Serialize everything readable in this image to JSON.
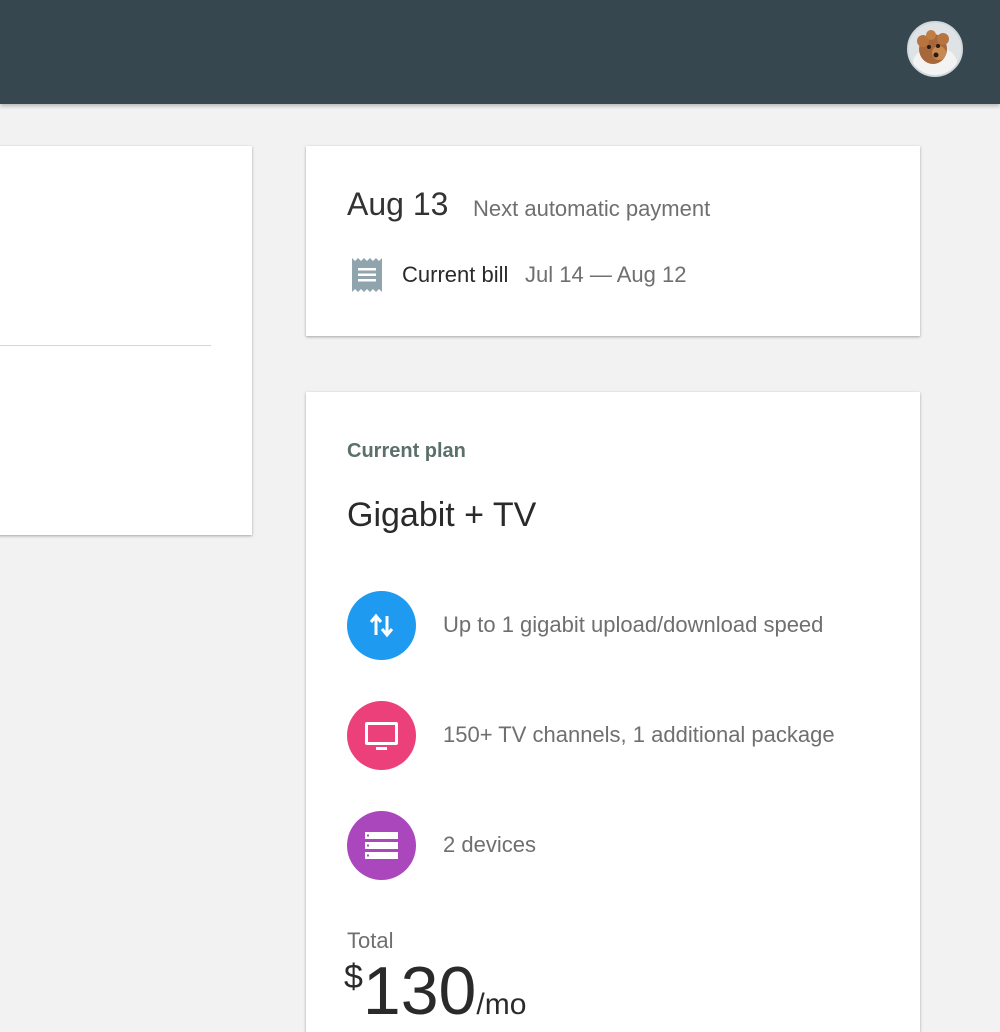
{
  "header": {
    "avatar_alt": "User avatar"
  },
  "payment": {
    "date": "Aug 13",
    "next_label": "Next automatic payment",
    "bill_label": "Current bill",
    "bill_range": "Jul 14 — Aug 12"
  },
  "plan": {
    "heading": "Current plan",
    "name": "Gigabit + TV",
    "features": [
      {
        "icon": "upload-download-icon",
        "color": "#1e9bf0",
        "text": "Up to 1 gigabit upload/download speed"
      },
      {
        "icon": "tv-icon",
        "color": "#ec407a",
        "text": "150+ TV channels, 1 additional package"
      },
      {
        "icon": "devices-icon",
        "color": "#ab47bc",
        "text": "2 devices"
      }
    ],
    "total_label": "Total",
    "currency": "$",
    "amount": "130",
    "period": "/mo"
  },
  "colors": {
    "header_bg": "#37474f",
    "page_bg": "#f2f2f2",
    "plan_heading": "#5b6f6b"
  }
}
